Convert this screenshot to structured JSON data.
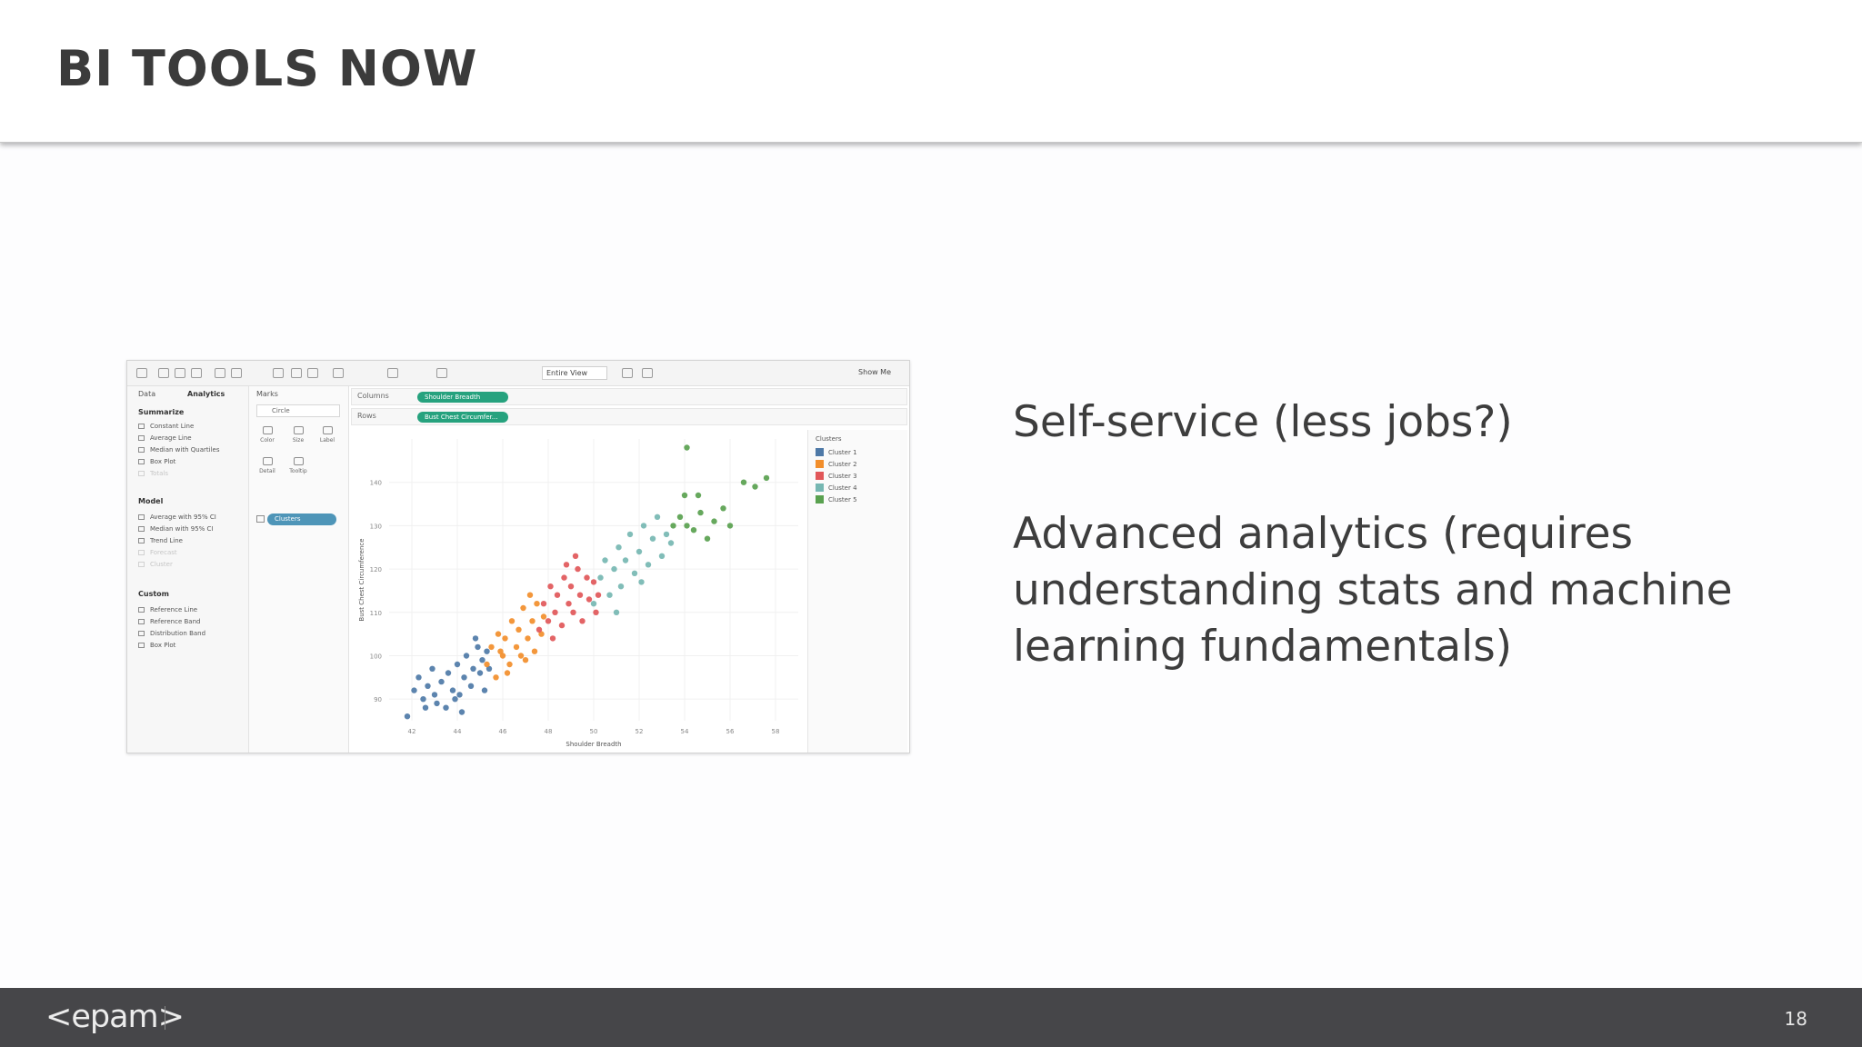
{
  "slide": {
    "title": "BI TOOLS NOW",
    "page_number": "18",
    "logo_text": "<epam>",
    "bullets": [
      "Self-service (less jobs?)",
      "Advanced analytics (requires understanding stats and machine learning fundamentals)"
    ]
  },
  "screenshot": {
    "toolbar": {
      "view_mode": "Entire View",
      "show_me": "Show Me"
    },
    "tabs": {
      "data": "Data",
      "analytics": "Analytics"
    },
    "analytics_pane": {
      "summarize_header": "Summarize",
      "summarize_items": [
        "Constant Line",
        "Average Line",
        "Median with Quartiles",
        "Box Plot",
        "Totals"
      ],
      "model_header": "Model",
      "model_items": [
        "Average with 95% CI",
        "Median with 95% CI",
        "Trend Line",
        "Forecast",
        "Cluster"
      ],
      "custom_header": "Custom",
      "custom_items": [
        "Reference Line",
        "Reference Band",
        "Distribution Band",
        "Box Plot"
      ]
    },
    "marks": {
      "title": "Marks",
      "type": "Circle",
      "buttons": [
        "Color",
        "Size",
        "Label",
        "Detail",
        "Tooltip"
      ],
      "pill": "Clusters"
    },
    "shelves": {
      "columns_label": "Columns",
      "columns_pill": "Shoulder Breadth",
      "rows_label": "Rows",
      "rows_pill": "Bust Chest Circumfer..."
    },
    "legend": {
      "title": "Clusters",
      "items": [
        {
          "label": "Cluster 1",
          "color": "#4e79a7"
        },
        {
          "label": "Cluster 2",
          "color": "#f28e2b"
        },
        {
          "label": "Cluster 3",
          "color": "#e15759"
        },
        {
          "label": "Cluster 4",
          "color": "#76b7b2"
        },
        {
          "label": "Cluster 5",
          "color": "#59a14f"
        }
      ]
    }
  },
  "chart_data": {
    "type": "scatter",
    "title": "",
    "xlabel": "Shoulder Breadth",
    "ylabel": "Bust Chest Circumference",
    "xlim": [
      41,
      59
    ],
    "ylim": [
      85,
      150
    ],
    "x_ticks": [
      42,
      44,
      46,
      48,
      50,
      52,
      54,
      56,
      58
    ],
    "y_ticks": [
      90,
      100,
      110,
      120,
      130,
      140
    ],
    "grid": true,
    "legend_position": "right",
    "series": [
      {
        "name": "Cluster 1",
        "color": "#4e79a7",
        "points": [
          [
            41.8,
            86
          ],
          [
            42.1,
            92
          ],
          [
            42.3,
            95
          ],
          [
            42.5,
            90
          ],
          [
            42.7,
            93
          ],
          [
            42.9,
            97
          ],
          [
            43.1,
            89
          ],
          [
            43.3,
            94
          ],
          [
            43.5,
            88
          ],
          [
            43.6,
            96
          ],
          [
            43.8,
            92
          ],
          [
            44.0,
            98
          ],
          [
            44.1,
            91
          ],
          [
            44.3,
            95
          ],
          [
            44.4,
            100
          ],
          [
            44.6,
            93
          ],
          [
            44.7,
            97
          ],
          [
            44.9,
            102
          ],
          [
            45.0,
            96
          ],
          [
            45.1,
            99
          ],
          [
            45.2,
            92
          ],
          [
            45.3,
            101
          ],
          [
            43.0,
            91
          ],
          [
            42.6,
            88
          ],
          [
            44.2,
            87
          ],
          [
            43.9,
            90
          ],
          [
            45.4,
            97
          ],
          [
            44.8,
            104
          ]
        ]
      },
      {
        "name": "Cluster 2",
        "color": "#f28e2b",
        "points": [
          [
            45.3,
            98
          ],
          [
            45.5,
            102
          ],
          [
            45.7,
            95
          ],
          [
            45.8,
            105
          ],
          [
            46.0,
            100
          ],
          [
            46.1,
            104
          ],
          [
            46.3,
            98
          ],
          [
            46.4,
            108
          ],
          [
            46.6,
            102
          ],
          [
            46.7,
            106
          ],
          [
            46.9,
            111
          ],
          [
            47.0,
            99
          ],
          [
            47.1,
            104
          ],
          [
            47.3,
            108
          ],
          [
            47.4,
            101
          ],
          [
            47.5,
            112
          ],
          [
            47.7,
            105
          ],
          [
            47.8,
            109
          ],
          [
            46.2,
            96
          ],
          [
            45.9,
            101
          ],
          [
            47.2,
            114
          ],
          [
            46.8,
            100
          ]
        ]
      },
      {
        "name": "Cluster 3",
        "color": "#e15759",
        "points": [
          [
            47.6,
            106
          ],
          [
            47.8,
            112
          ],
          [
            48.0,
            108
          ],
          [
            48.1,
            116
          ],
          [
            48.3,
            110
          ],
          [
            48.4,
            114
          ],
          [
            48.6,
            107
          ],
          [
            48.7,
            118
          ],
          [
            48.9,
            112
          ],
          [
            49.0,
            116
          ],
          [
            49.1,
            110
          ],
          [
            49.3,
            120
          ],
          [
            49.4,
            114
          ],
          [
            49.5,
            108
          ],
          [
            49.7,
            118
          ],
          [
            49.8,
            113
          ],
          [
            50.0,
            117
          ],
          [
            50.1,
            110
          ],
          [
            48.2,
            104
          ],
          [
            49.2,
            123
          ],
          [
            50.2,
            114
          ],
          [
            48.8,
            121
          ]
        ]
      },
      {
        "name": "Cluster 4",
        "color": "#76b7b2",
        "points": [
          [
            50.0,
            112
          ],
          [
            50.3,
            118
          ],
          [
            50.5,
            122
          ],
          [
            50.7,
            114
          ],
          [
            50.9,
            120
          ],
          [
            51.1,
            125
          ],
          [
            51.2,
            116
          ],
          [
            51.4,
            122
          ],
          [
            51.6,
            128
          ],
          [
            51.8,
            119
          ],
          [
            52.0,
            124
          ],
          [
            52.2,
            130
          ],
          [
            52.4,
            121
          ],
          [
            52.6,
            127
          ],
          [
            52.8,
            132
          ],
          [
            53.0,
            123
          ],
          [
            53.2,
            128
          ],
          [
            51.0,
            110
          ],
          [
            52.1,
            117
          ],
          [
            53.4,
            126
          ]
        ]
      },
      {
        "name": "Cluster 5",
        "color": "#59a14f",
        "points": [
          [
            53.5,
            130
          ],
          [
            53.8,
            132
          ],
          [
            54.1,
            130
          ],
          [
            54.4,
            129
          ],
          [
            54.7,
            133
          ],
          [
            55.0,
            127
          ],
          [
            55.3,
            131
          ],
          [
            54.0,
            137
          ],
          [
            54.6,
            137
          ],
          [
            55.7,
            134
          ],
          [
            56.0,
            130
          ],
          [
            56.6,
            140
          ],
          [
            57.1,
            139
          ],
          [
            57.6,
            141
          ],
          [
            54.1,
            148
          ]
        ]
      }
    ]
  }
}
